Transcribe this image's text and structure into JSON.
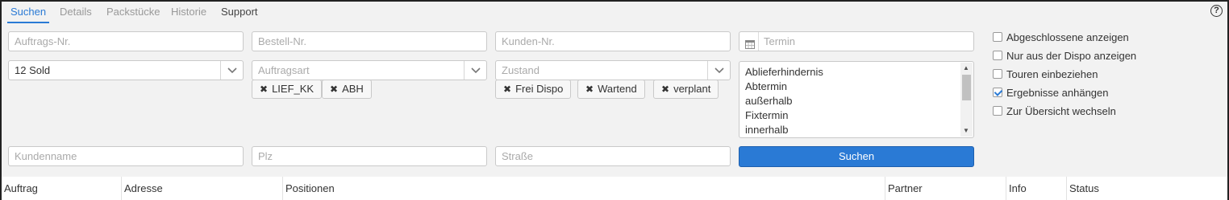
{
  "tabs": [
    {
      "label": "Suchen"
    },
    {
      "label": "Details"
    },
    {
      "label": "Packstücke"
    },
    {
      "label": "Historie"
    },
    {
      "label": "Support"
    }
  ],
  "help_label": "?",
  "search": {
    "auftrags_nr_placeholder": "Auftrags-Nr.",
    "bestell_nr_placeholder": "Bestell-Nr.",
    "kunden_nr_placeholder": "Kunden-Nr.",
    "termin_placeholder": "Termin",
    "sold_value": "12 Sold",
    "auftragsart_placeholder": "Auftragsart",
    "zustand_placeholder": "Zustand",
    "auftragsart_chips": [
      "LIEF_KK",
      "ABH"
    ],
    "zustand_chips": [
      "Frei Dispo",
      "Wartend",
      "verplant"
    ],
    "list_options": [
      "Ablieferhindernis",
      "Abtermin",
      "außerhalb",
      "Fixtermin",
      "innerhalb"
    ],
    "kundenname_placeholder": "Kundenname",
    "plz_placeholder": "Plz",
    "strasse_placeholder": "Straße",
    "search_button": "Suchen"
  },
  "options": [
    {
      "label": "Abgeschlossene anzeigen",
      "checked": false
    },
    {
      "label": "Nur aus der Dispo anzeigen",
      "checked": false
    },
    {
      "label": "Touren einbeziehen",
      "checked": false
    },
    {
      "label": "Ergebnisse anhängen",
      "checked": true
    },
    {
      "label": "Zur Übersicht wechseln",
      "checked": false
    }
  ],
  "table": {
    "columns": [
      "Auftrag",
      "Adresse",
      "Positionen",
      "Partner",
      "Info",
      "Status"
    ]
  },
  "colors": {
    "accent": "#2a7ad5",
    "background": "#f2f2f2"
  }
}
